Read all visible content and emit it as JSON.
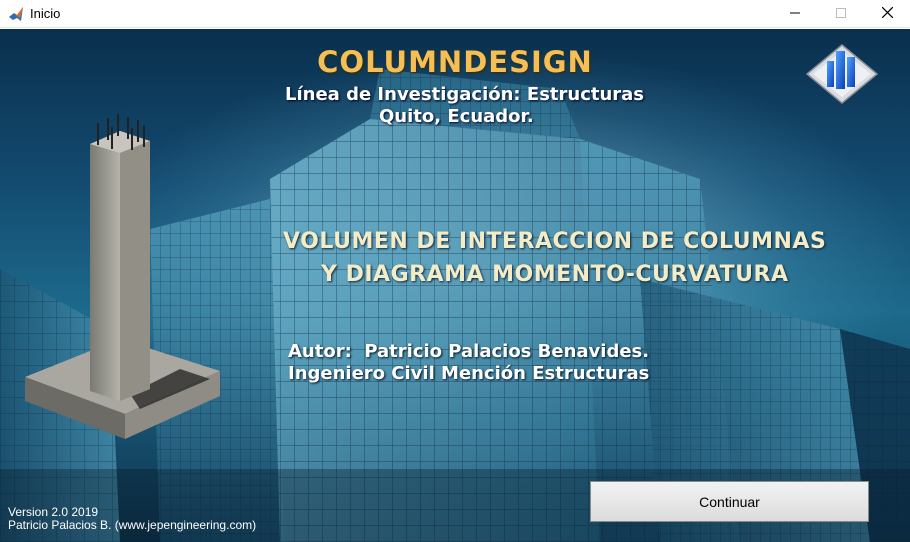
{
  "window": {
    "title": "Inicio",
    "icon": "matlab-icon",
    "controls": {
      "minimize": "minimize-icon",
      "maximize": "maximize-icon",
      "close": "close-icon"
    }
  },
  "splash": {
    "app_name": "COLUMNDESIGN",
    "research_line": "Línea de Investigación: Estructuras",
    "location": "Quito, Ecuador.",
    "subtitle_line1": "VOLUMEN DE INTERACCION DE COLUMNAS",
    "subtitle_line2": "Y DIAGRAMA MOMENTO-CURVATURA",
    "author_line": "Autor:  Patricio Palacios Benavides.",
    "author_title": "Ingeniero Civil Mención Estructuras",
    "version": "Version 2.0 2019",
    "credit": "Patricio Palacios B. (www.jepengineering.com)",
    "continue_label": "Continuar"
  },
  "colors": {
    "app_name": "#f5bf55",
    "subtitle": "#f2ecc8",
    "background_dark": "#0a2f4d",
    "background_light": "#1d6a8c"
  }
}
